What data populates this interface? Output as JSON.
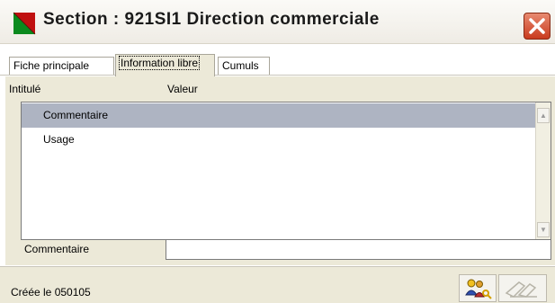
{
  "window": {
    "title": "Section : 921SI1 Direction commerciale"
  },
  "tabs": [
    {
      "label": "Fiche principale",
      "active": false
    },
    {
      "label": "Information libre",
      "active": true
    },
    {
      "label": "Cumuls",
      "active": false
    }
  ],
  "list": {
    "columns": [
      "Intitulé",
      "Valeur"
    ],
    "rows": [
      {
        "intitule": "Commentaire",
        "valeur": "",
        "selected": true
      },
      {
        "intitule": "Usage",
        "valeur": "",
        "selected": false
      }
    ]
  },
  "editor": {
    "label": "Commentaire",
    "value": ""
  },
  "status": {
    "text": "Créée le 050105"
  },
  "icons": {
    "app": "section-app-icon",
    "close": "close-icon",
    "tool_left": "users-key-icon",
    "tool_right": "disabled-tools-icon"
  },
  "colors": {
    "selected_row": "#aeb4c2",
    "panel": "#ece9d8",
    "close": "#c93b1e"
  }
}
